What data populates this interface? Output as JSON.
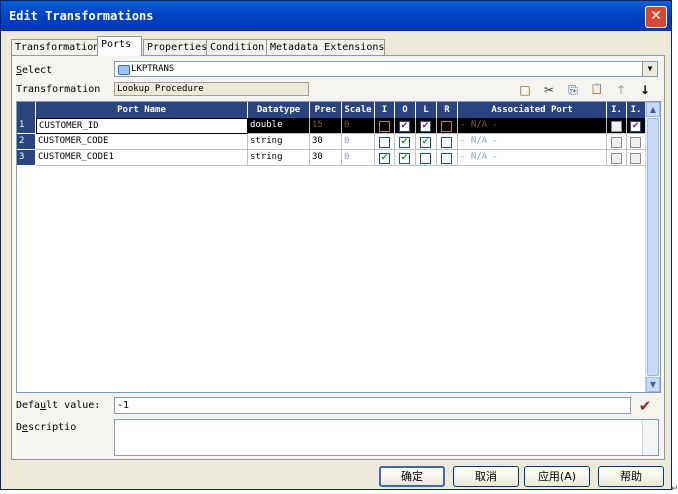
{
  "window": {
    "title": "Edit Transformations",
    "close_glyph": "✕"
  },
  "tabs": [
    {
      "label": "Transformation"
    },
    {
      "label": "Ports",
      "active": true
    },
    {
      "label": "Properties"
    },
    {
      "label": "Condition"
    },
    {
      "label": "Metadata Extensions"
    }
  ],
  "form": {
    "select_label_u": "S",
    "select_label_rest": "elect",
    "select_value": "LKPTRANS",
    "transformation_label": "Transformation",
    "transformation_value": "Lookup Procedure",
    "default_label_pre": "Defa",
    "default_label_u": "u",
    "default_label_post": "lt value:",
    "default_value": "-1",
    "description_label_pre": "D",
    "description_label_u": "e",
    "description_label_post": "scriptio"
  },
  "toolbar": {
    "icons": [
      "new-port-icon",
      "cut-icon",
      "copy-icon",
      "paste-icon",
      "move-up-icon",
      "move-down-icon"
    ],
    "glyphs": [
      "□",
      "✂",
      "⎘",
      "📋",
      "↑",
      "↓"
    ]
  },
  "grid": {
    "columns": [
      "Port Name",
      "Datatype",
      "Prec",
      "Scale",
      "I",
      "O",
      "L",
      "R",
      "Associated Port",
      "I.",
      "I."
    ],
    "rows": [
      {
        "num": "1",
        "port_name": "CUSTOMER_ID",
        "datatype": "double",
        "prec": "15",
        "scale": "0",
        "I": false,
        "O": true,
        "L": true,
        "R": false,
        "assoc": "- N/A -",
        "i1": false,
        "i2": true,
        "selected": true
      },
      {
        "num": "2",
        "port_name": "CUSTOMER_CODE",
        "datatype": "string",
        "prec": "30",
        "scale": "0",
        "I": false,
        "O": true,
        "L": true,
        "R": false,
        "assoc": "- N/A -",
        "i1": false,
        "i2": false,
        "selected": false
      },
      {
        "num": "3",
        "port_name": "CUSTOMER_CODE1",
        "datatype": "string",
        "prec": "30",
        "scale": "0",
        "I": true,
        "O": true,
        "L": false,
        "R": false,
        "assoc": "- N/A -",
        "i1": false,
        "i2": false,
        "selected": false
      }
    ]
  },
  "buttons": {
    "ok": "确定",
    "cancel": "取消",
    "apply": "应用(A)",
    "help": "帮助"
  },
  "check_glyph": "✔"
}
